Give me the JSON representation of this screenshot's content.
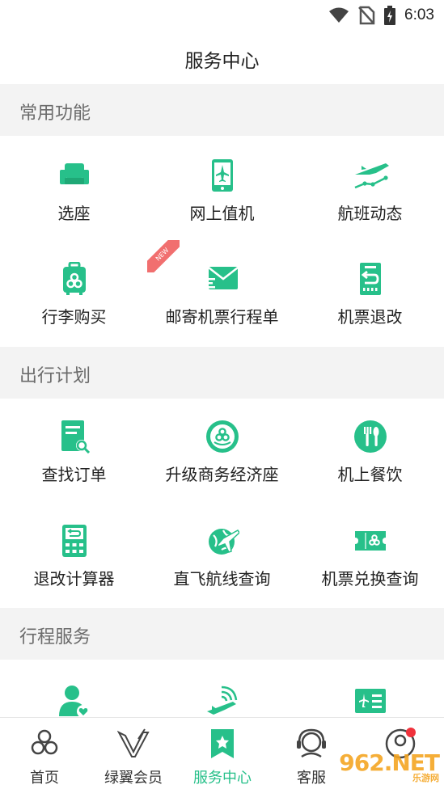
{
  "status_bar": {
    "time": "6:03"
  },
  "header": {
    "title": "服务中心"
  },
  "sections": [
    {
      "title": "常用功能",
      "items": [
        {
          "label": "选座",
          "icon": "seat-icon"
        },
        {
          "label": "网上值机",
          "icon": "online-checkin-icon"
        },
        {
          "label": "航班动态",
          "icon": "flight-status-icon"
        },
        {
          "label": "行李购买",
          "icon": "luggage-icon"
        },
        {
          "label": "邮寄机票行程单",
          "icon": "mail-itinerary-icon",
          "badge": "NEW"
        },
        {
          "label": "机票退改",
          "icon": "ticket-refund-icon"
        }
      ]
    },
    {
      "title": "出行计划",
      "items": [
        {
          "label": "查找订单",
          "icon": "order-search-icon"
        },
        {
          "label": "升级商务经济座",
          "icon": "upgrade-seat-icon"
        },
        {
          "label": "机上餐饮",
          "icon": "meal-icon"
        },
        {
          "label": "退改计算器",
          "icon": "calculator-icon"
        },
        {
          "label": "直飞航线查询",
          "icon": "route-globe-icon"
        },
        {
          "label": "机票兑换查询",
          "icon": "ticket-exchange-icon"
        }
      ]
    },
    {
      "title": "行程服务",
      "items": [
        {
          "label": "",
          "icon": "passenger-service-icon"
        },
        {
          "label": "",
          "icon": "wifi-plane-icon"
        },
        {
          "label": "",
          "icon": "boarding-pass-icon"
        }
      ]
    }
  ],
  "tabbar": [
    {
      "label": "首页",
      "icon": "home-logo-icon"
    },
    {
      "label": "绿翼会员",
      "icon": "member-wings-icon"
    },
    {
      "label": "服务中心",
      "icon": "service-center-icon",
      "active": true
    },
    {
      "label": "客服",
      "icon": "headset-icon"
    },
    {
      "label": "",
      "icon": "profile-icon",
      "has_dot": true
    }
  ],
  "watermark": {
    "text": "962.NET",
    "sub": "乐游网"
  },
  "colors": {
    "accent": "#27c08a",
    "section_bg": "#f3f3f3",
    "badge": "#f16f6f",
    "dot": "#f0323c"
  }
}
